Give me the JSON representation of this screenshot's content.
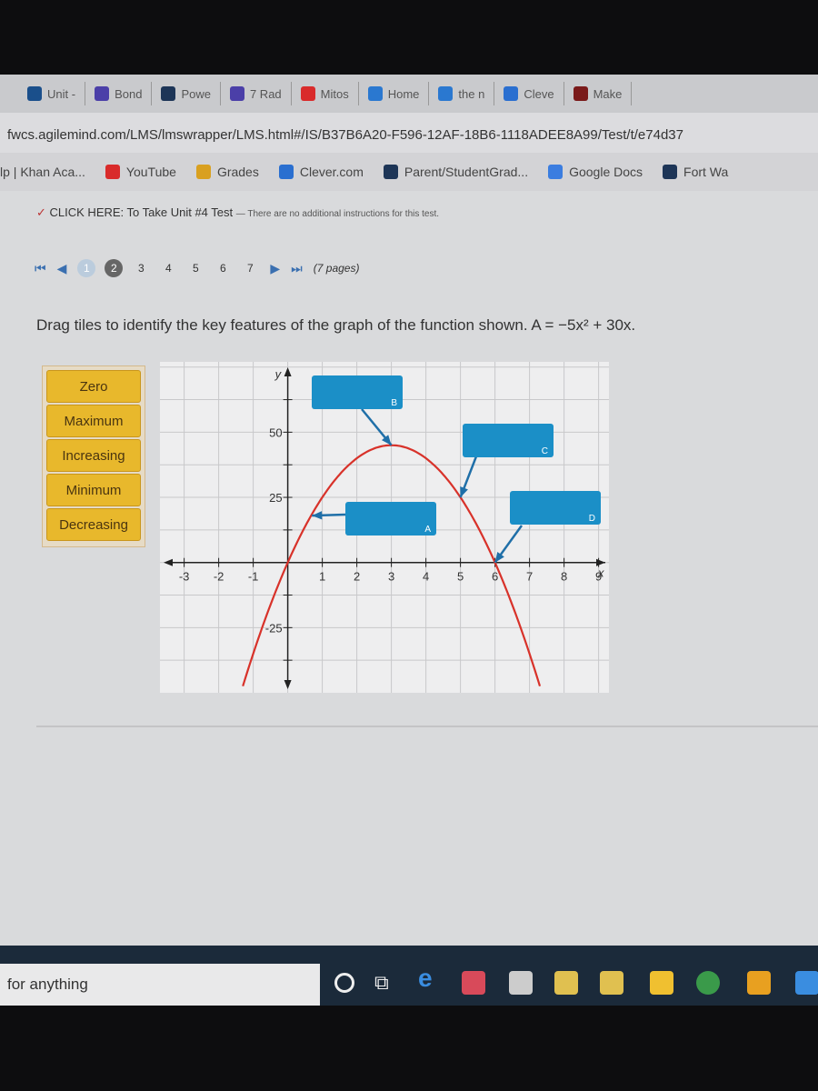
{
  "browser": {
    "tabs": [
      {
        "label": "Unit -",
        "icon": "khan-icon",
        "color": "#1a4f8b"
      },
      {
        "label": "Bond",
        "icon": "list-icon",
        "color": "#4b3fa8"
      },
      {
        "label": "Powe",
        "icon": "p-icon",
        "color": "#1d3557"
      },
      {
        "label": "7 Rad",
        "icon": "list-icon",
        "color": "#4b3fa8"
      },
      {
        "label": "Mitos",
        "icon": "youtube-icon",
        "color": "#d92b2b"
      },
      {
        "label": "Home",
        "icon": "c-circle-icon",
        "color": "#2a78d0"
      },
      {
        "label": "the n",
        "icon": "c-circle-icon",
        "color": "#2a78d0"
      },
      {
        "label": "Cleve",
        "icon": "clever-icon",
        "color": "#2a6fd0"
      },
      {
        "label": "Make",
        "icon": "make-icon",
        "color": "#7a1a1a"
      }
    ],
    "url": "fwcs.agilemind.com/LMS/lmswrapper/LMS.html#/IS/B37B6A20-F596-12AF-18B6-1118ADEE8A99/Test/t/e74d37",
    "bookmarks": [
      {
        "label": "lp | Khan Aca...",
        "icon": "",
        "color": ""
      },
      {
        "label": "YouTube",
        "icon": "youtube-icon",
        "color": "#d92b2b"
      },
      {
        "label": "Grades",
        "icon": "grades-icon",
        "color": "#d9a020"
      },
      {
        "label": "Clever.com",
        "icon": "clever-icon",
        "color": "#2a6fd0"
      },
      {
        "label": "Parent/StudentGrad...",
        "icon": "p-icon",
        "color": "#1d3557"
      },
      {
        "label": "Google Docs",
        "icon": "docs-icon",
        "color": "#3b7de0"
      },
      {
        "label": "Fort Wa",
        "icon": "fw-icon",
        "color": "#1d3557"
      }
    ]
  },
  "notice": {
    "link": "CLICK HERE: To Take Unit #4 Test",
    "note": "— There are no additional instructions for this test."
  },
  "pager": {
    "pages": [
      "1",
      "2",
      "3",
      "4",
      "5",
      "6",
      "7"
    ],
    "current": "2",
    "total": "(7 pages)"
  },
  "question": {
    "prompt": "Drag tiles to identify the key features of the graph of the function shown. A = −5x² + 30x."
  },
  "tiles": [
    "Zero",
    "Maximum",
    "Increasing",
    "Minimum",
    "Decreasing"
  ],
  "targets": [
    "B",
    "C",
    "A",
    "D"
  ],
  "chart_data": {
    "type": "line",
    "function": "A = -5x^2 + 30x",
    "xlabel": "x",
    "ylabel": "y",
    "xticks": [
      -3,
      -2,
      -1,
      1,
      2,
      3,
      4,
      5,
      6,
      7,
      8,
      9
    ],
    "yticks": [
      {
        "v": 50,
        "label": "50"
      },
      {
        "v": 25,
        "label": "25"
      },
      {
        "v": -25,
        "label": "-25"
      }
    ],
    "xlim": [
      -3.7,
      9.3
    ],
    "ylim": [
      -50,
      77
    ],
    "grid": true,
    "curve_color": "#d8322a",
    "drop_targets": [
      {
        "label": "B",
        "points_to": [
          3,
          45
        ]
      },
      {
        "label": "C",
        "points_to": [
          5,
          25
        ]
      },
      {
        "label": "A",
        "points_to": [
          0.7,
          18
        ]
      },
      {
        "label": "D",
        "points_to": [
          6,
          0
        ]
      }
    ]
  },
  "taskbar": {
    "search": "for anything"
  }
}
